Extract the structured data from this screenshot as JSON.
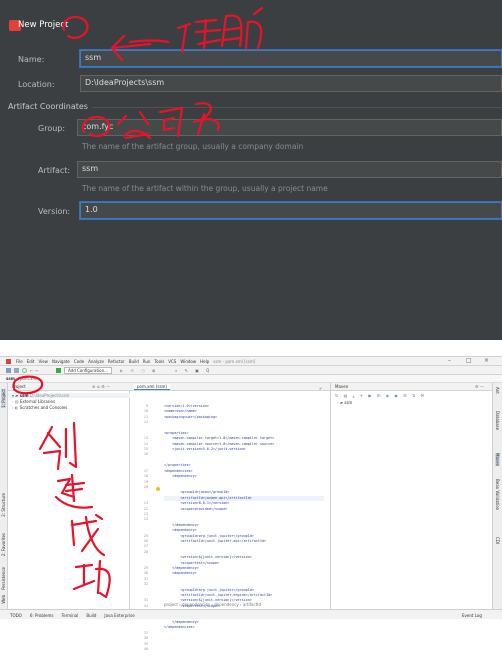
{
  "dialog": {
    "title": "New Project",
    "name_label": "Name:",
    "name_value": "ssm",
    "location_label": "Location:",
    "location_value": "D:\\IdeaProjects\\ssm",
    "artifact_section": "Artifact Coordinates",
    "group_label": "Group:",
    "group_value": "com.fyc",
    "group_hint": "The name of the artifact group, usually a company domain",
    "artifact_label": "Artifact:",
    "artifact_value": "ssm",
    "artifact_hint": "The name of the artifact within the group, usually a project name",
    "version_label": "Version:",
    "version_value": "1.0"
  },
  "ide": {
    "menu": [
      "File",
      "Edit",
      "View",
      "Navigate",
      "Code",
      "Analyze",
      "Refactor",
      "Build",
      "Run",
      "Tools",
      "VCS",
      "Window",
      "Help"
    ],
    "window_title": "ssm - pom.xml [ssm]",
    "add_configuration": "Add Configuration...",
    "breadcrumb_project": "ssm",
    "breadcrumb_file": "pom.xml",
    "project_panel_title": "Project",
    "editor_tab": "pom.xml (ssm)",
    "tree": [
      {
        "label": "ssm",
        "path": "D:\\IdeaProjects\\ssm"
      },
      {
        "label": "External Libraries"
      },
      {
        "label": "Scratches and Consoles"
      }
    ],
    "line_numbers": [
      "9",
      "10",
      "11",
      "12",
      "13",
      "14",
      "15",
      "16",
      "17",
      "18",
      "19",
      "20",
      "21",
      "22",
      "23",
      "24",
      "25",
      "26",
      "27",
      "28",
      "29",
      "30",
      "31",
      "32",
      "33",
      "34",
      "35",
      "36",
      "37",
      "38",
      "39",
      "40"
    ],
    "code_lines": [
      "<version>1.0</version>",
      "<name>ssm</name>",
      "<packaging>war</packaging>",
      "",
      "<properties>",
      "    <maven.compiler.target>1.8</maven.compiler.target>",
      "    <maven.compiler.source>1.8</maven.compiler.source>",
      "    <junit.version>5.6.2</junit.version>",
      "</properties>",
      "",
      "<dependencies>",
      "    <dependency>",
      "        <groupId>javax</groupId>",
      "        <artifactId>javaee-api</artifactId>",
      "        <version>8.0.1</version>",
      "        <scope>provided</scope>",
      "    </dependency>",
      "    <dependency>",
      "        <groupId>org.junit.jupiter</groupId>",
      "        <artifactId>junit-jupiter-api</artifactId>",
      "        <version>${junit.version}</version>",
      "        <scope>test</scope>",
      "    </dependency>",
      "    <dependency>",
      "        <groupId>org.junit.jupiter</groupId>",
      "        <artifactId>junit-jupiter-engine</artifactId>",
      "        <version>${junit.version}</version>",
      "        <scope>test</scope>",
      "    </dependency>",
      "</dependencies>",
      "",
      ""
    ],
    "editor_breadcrumb": "project  ›  dependencies  ›  dependency  ›  artifactId",
    "maven_title": "Maven",
    "maven_item": "ssm",
    "right_tabs": [
      "Ant",
      "Database",
      "Maven",
      "Bean Validation",
      "CDI"
    ],
    "left_tabs": [
      "1: Project",
      "2: Structure",
      "2: Favorites",
      "Persistence",
      "Web"
    ],
    "status_items": [
      "TODO",
      "6: Problems",
      "Terminal",
      "Build",
      "Java Enterprise"
    ],
    "event_log": "Event Log"
  }
}
